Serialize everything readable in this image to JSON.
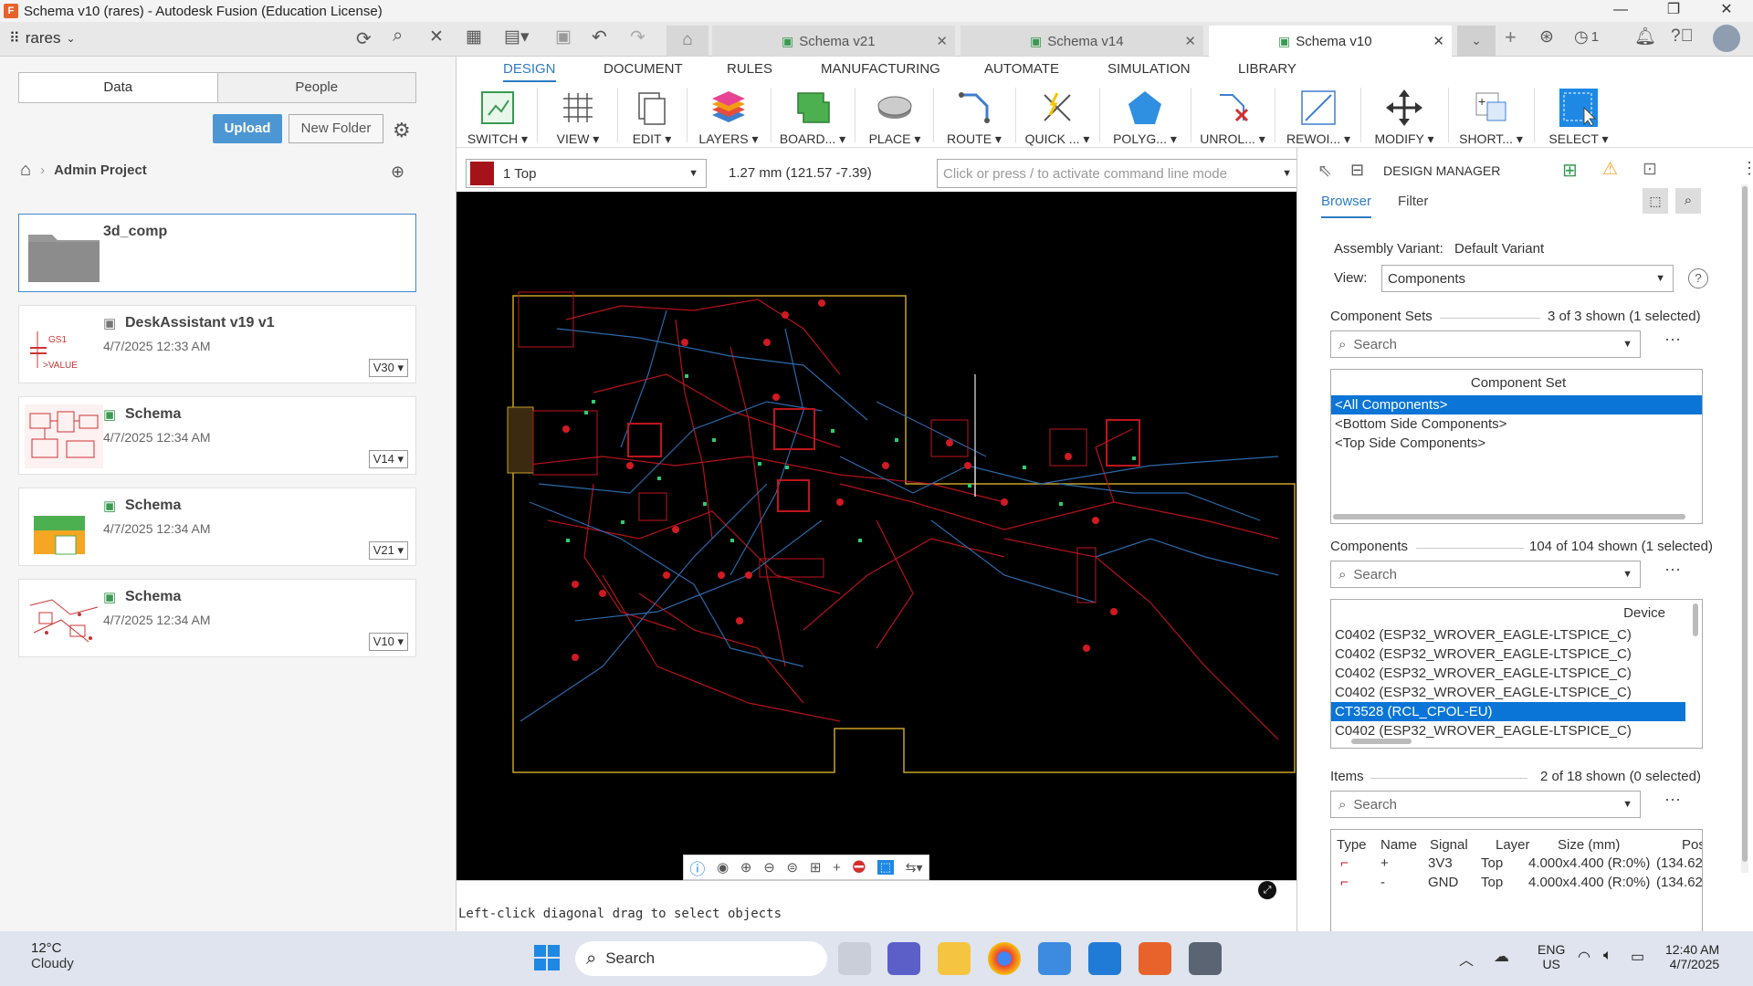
{
  "window": {
    "title": "Schema v10 (rares) - Autodesk Fusion (Education License)"
  },
  "topbar": {
    "user": "rares",
    "tabs": [
      {
        "label": "Schema v21"
      },
      {
        "label": "Schema v14"
      },
      {
        "label": "Schema v10"
      }
    ],
    "jobs_count": "1"
  },
  "datapanel": {
    "tab_data": "Data",
    "tab_people": "People",
    "upload_label": "Upload",
    "new_folder_label": "New Folder",
    "breadcrumb": "Admin Project",
    "items": [
      {
        "name": "3d_comp",
        "date": "",
        "version": ""
      },
      {
        "name": "DeskAssistant v19 v1",
        "date": "4/7/2025 12:33 AM",
        "version": "V30"
      },
      {
        "name": "Schema",
        "date": "4/7/2025 12:34 AM",
        "version": "V14"
      },
      {
        "name": "Schema",
        "date": "4/7/2025 12:34 AM",
        "version": "V21"
      },
      {
        "name": "Schema",
        "date": "4/7/2025 12:34 AM",
        "version": "V10"
      }
    ],
    "thumb_gs1": "GS1",
    "thumb_value": ">VALUE"
  },
  "ribbon": {
    "tabs": [
      "DESIGN",
      "DOCUMENT",
      "RULES",
      "MANUFACTURING",
      "AUTOMATE",
      "SIMULATION",
      "LIBRARY"
    ],
    "groups": [
      "SWITCH ▾",
      "VIEW ▾",
      "EDIT ▾",
      "LAYERS ▾",
      "BOARD... ▾",
      "PLACE ▾",
      "ROUTE ▾",
      "QUICK ... ▾",
      "POLYG... ▾",
      "UNROL... ▾",
      "REWOI... ▾",
      "MODIFY ▾",
      "SHORT... ▾",
      "SELECT ▾"
    ]
  },
  "cmdrow": {
    "layer": "1 Top",
    "coords": "1.27 mm (121.57 -7.39)",
    "cmd_placeholder": "Click or press / to activate command line mode"
  },
  "status": {
    "message": "Left-click diagonal drag to select objects"
  },
  "design_manager": {
    "title": "DESIGN MANAGER",
    "tab_browser": "Browser",
    "tab_filter": "Filter",
    "assembly_variant_label": "Assembly Variant:",
    "assembly_variant_value": "Default Variant",
    "view_label": "View:",
    "view_value": "Components",
    "component_sets_label": "Component Sets",
    "component_sets_count": "3 of 3 shown (1 selected)",
    "search_placeholder": "Search",
    "component_set_header": "Component Set",
    "component_sets": [
      "<All Components>",
      "<Bottom Side Components>",
      "<Top Side Components>"
    ],
    "components_label": "Components",
    "components_count": "104 of 104 shown (1 selected)",
    "device_header": "Device",
    "components": [
      "C0402 (ESP32_WROVER_EAGLE-LTSPICE_C)",
      "C0402 (ESP32_WROVER_EAGLE-LTSPICE_C)",
      "C0402 (ESP32_WROVER_EAGLE-LTSPICE_C)",
      "C0402 (ESP32_WROVER_EAGLE-LTSPICE_C)",
      "CT3528 (RCL_CPOL-EU)",
      "C0402 (ESP32_WROVER_EAGLE-LTSPICE_C)"
    ],
    "items_label": "Items",
    "items_count": "2 of 18 shown (0 selected)",
    "items_headers": [
      "Type",
      "Name",
      "Signal",
      "Layer",
      "Size (mm)",
      "Pos"
    ],
    "items_rows": [
      [
        "+",
        "3V3",
        "Top",
        "4.000x4.400 (R:0%)",
        "(134.62"
      ],
      [
        "-",
        "GND",
        "Top",
        "4.000x4.400 (R:0%)",
        "(134.62"
      ]
    ]
  },
  "taskbar": {
    "weather_temp": "12°C",
    "weather_desc": "Cloudy",
    "search_label": "Search",
    "lang": "ENG",
    "region": "US",
    "time": "12:40 AM",
    "date": "4/7/2025"
  },
  "colors": {
    "accent": "#2e7cc4",
    "selection": "#0a75d6",
    "pcb_top": "#c0141c",
    "pcb_bottom": "#2f6fb4",
    "canvas": "#000000"
  }
}
